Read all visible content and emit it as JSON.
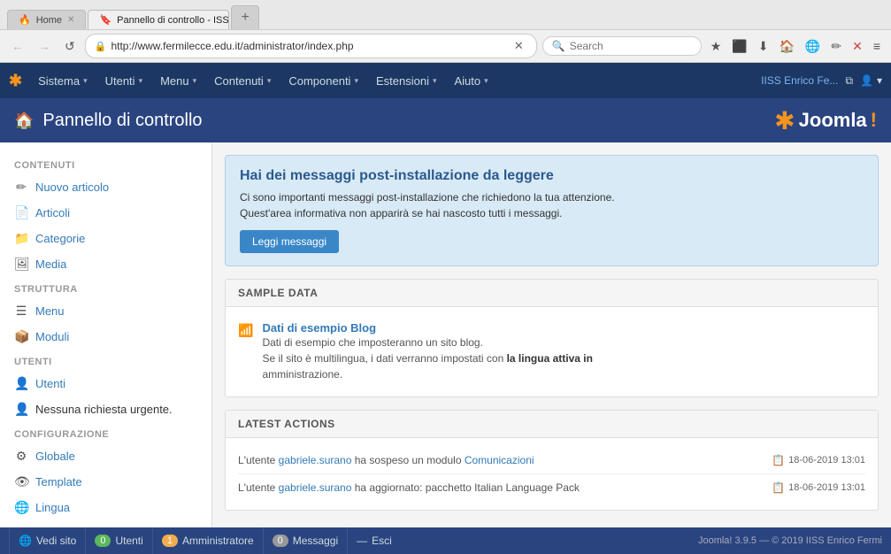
{
  "browser": {
    "tabs": [
      {
        "id": "tab1",
        "label": "Home",
        "icon": "🔥",
        "active": false,
        "closable": true
      },
      {
        "id": "tab2",
        "label": "Pannello di controllo - ISS...",
        "icon": "🔖",
        "active": true,
        "closable": true
      },
      {
        "id": "tab3",
        "label": "",
        "icon": "+",
        "active": false,
        "closable": false
      }
    ],
    "nav": {
      "back_title": "←",
      "forward_title": "→",
      "refresh_title": "↺",
      "url": "http://www.fermilecce.edu.it/administrator/index.php",
      "search_placeholder": "Search"
    },
    "toolbar_icons": [
      "★",
      "⬛",
      "⬇",
      "🏠",
      "🌐",
      "✏",
      "✕",
      "≡"
    ]
  },
  "topbar": {
    "logo": "✱",
    "menu_items": [
      {
        "label": "Sistema",
        "has_caret": true
      },
      {
        "label": "Utenti",
        "has_caret": true
      },
      {
        "label": "Menu",
        "has_caret": true
      },
      {
        "label": "Contenuti",
        "has_caret": true
      },
      {
        "label": "Componenti",
        "has_caret": true
      },
      {
        "label": "Estensioni",
        "has_caret": true
      },
      {
        "label": "Aiuto",
        "has_caret": true
      }
    ],
    "site_name": "IISS Enrico Fe...",
    "site_icon": "⧉",
    "user_icon": "👤",
    "user_caret": "▾"
  },
  "header": {
    "home_icon": "🏠",
    "title": "Pannello di controllo",
    "joomla_text": "Joomla",
    "joomla_exclaim": "!"
  },
  "sidebar": {
    "sections": [
      {
        "title": "CONTENUTI",
        "items": [
          {
            "icon": "✏",
            "label": "Nuovo articolo",
            "link": true
          },
          {
            "icon": "📄",
            "label": "Articoli",
            "link": true
          },
          {
            "icon": "📁",
            "label": "Categorie",
            "link": true
          },
          {
            "icon": "🖼",
            "label": "Media",
            "link": true
          }
        ]
      },
      {
        "title": "STRUTTURA",
        "items": [
          {
            "icon": "☰",
            "label": "Menu",
            "link": true
          },
          {
            "icon": "📦",
            "label": "Moduli",
            "link": true
          }
        ]
      },
      {
        "title": "UTENTI",
        "items": [
          {
            "icon": "👤",
            "label": "Utenti",
            "link": true
          },
          {
            "icon": "👤",
            "label": "Nessuna richiesta urgente.",
            "link": false
          }
        ]
      },
      {
        "title": "CONFIGURAZIONE",
        "items": [
          {
            "icon": "⚙",
            "label": "Globale",
            "link": true
          },
          {
            "icon": "👁",
            "label": "Template",
            "link": true
          },
          {
            "icon": "🌐",
            "label": "Lingua",
            "link": true
          }
        ]
      }
    ]
  },
  "content": {
    "info_box": {
      "title": "Hai dei messaggi post-installazione da leggere",
      "line1": "Ci sono importanti messaggi post-installazione che richiedono la tua attenzione.",
      "line2": "Quest'area informativa non apparirà se hai nascosto tutti i messaggi.",
      "button_label": "Leggi messaggi"
    },
    "sample_data": {
      "section_title": "SAMPLE DATA",
      "items": [
        {
          "icon": "📶",
          "link_label": "Dati di esempio Blog",
          "desc_line1": "Dati di esempio che imposteranno un sito blog.",
          "desc_line2": "Se il sito è multilingua, i dati verranno impostati con",
          "desc_bold": "la lingua attiva in",
          "desc_line3": "amministrazione."
        }
      ]
    },
    "latest_actions": {
      "section_title": "LATEST ACTIONS",
      "items": [
        {
          "text_before": "L'utente ",
          "user_link": "gabriele.surano",
          "text_middle": " ha sospeso un modulo ",
          "module_link": "Comunicazioni",
          "text_after": "",
          "time": "18-06-2019 13:01"
        },
        {
          "text_before": "L'utente ",
          "user_link": "gabriele.surano",
          "text_middle": " ha aggiornato: pacchetto Italian Language Pack",
          "module_link": "",
          "text_after": "",
          "time": "18-06-2019 13:01"
        }
      ]
    }
  },
  "footer": {
    "items": [
      {
        "icon": "🌐",
        "label": "Vedi sito",
        "badge": null
      },
      {
        "badge_count": "0",
        "badge_color": "green",
        "label": "Utenti"
      },
      {
        "badge_count": "1",
        "badge_color": "orange",
        "label": "Amministratore"
      },
      {
        "badge_count": "0",
        "badge_color": "gray",
        "label": "Messaggi"
      },
      {
        "dash": true,
        "label": "Esci"
      }
    ],
    "copyright": "Joomla! 3.9.5 — © 2019 IISS Enrico Fermi"
  }
}
